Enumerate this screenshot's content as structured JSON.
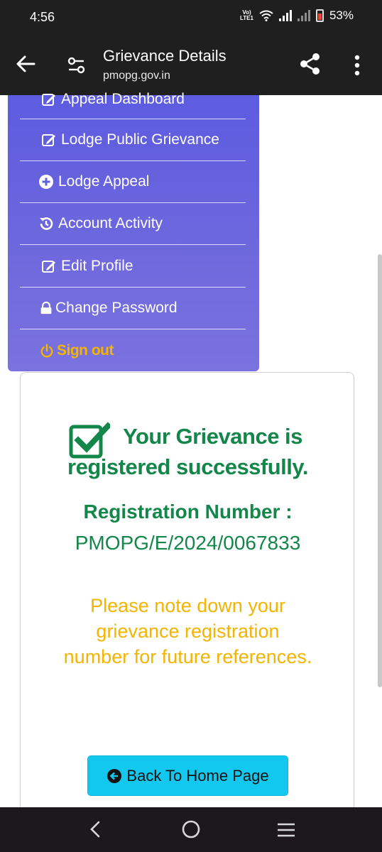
{
  "status_bar": {
    "time": "4:56",
    "network_tag": "Vo) LTE1",
    "battery": "53%"
  },
  "app_bar": {
    "title": "Grievance Details",
    "url": "pmopg.gov.in",
    "icons": [
      "back-arrow-icon",
      "tune-icon",
      "share-icon",
      "more-vert-icon"
    ]
  },
  "menu": {
    "items": [
      {
        "label": "Appeal Dashboard",
        "icon": "edit-icon"
      },
      {
        "label": "Lodge Public Grievance",
        "icon": "edit-icon"
      },
      {
        "label": "Lodge Appeal",
        "icon": "plus-circle-icon"
      },
      {
        "label": "Account Activity",
        "icon": "history-icon"
      },
      {
        "label": "Edit Profile",
        "icon": "edit-icon"
      },
      {
        "label": "Change Password",
        "icon": "lock-icon"
      },
      {
        "label": "Sign out",
        "icon": "power-icon"
      }
    ]
  },
  "result": {
    "heading_line1": "Your Grievance is",
    "heading_line2": "registered successfully.",
    "reg_label": "Registration Number :",
    "reg_number": "PMOPG/E/2024/0067833",
    "note": "Please note down your grievance registration number for future references.",
    "home_button": "Back To Home Page"
  },
  "colors": {
    "success_green": "#13864a",
    "warning_yellow": "#f4b400",
    "menu_purple": "#5d5be0",
    "button_cyan": "#13c8ef"
  }
}
